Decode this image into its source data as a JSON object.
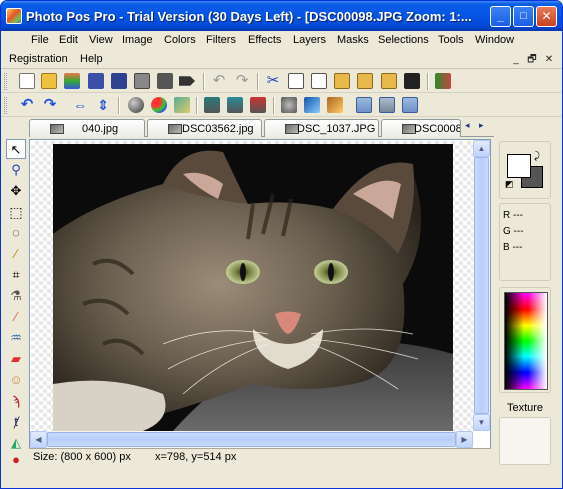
{
  "window": {
    "title": "Photo Pos Pro - Trial Version (30 Days Left) - [DSC00098.JPG  Zoom: 1:...",
    "controls": {
      "minimize": "_",
      "maximize": "□",
      "close": "✕"
    }
  },
  "menubar": {
    "items": [
      "File",
      "Edit",
      "View",
      "Image",
      "Colors",
      "Filters",
      "Effects",
      "Layers",
      "Masks",
      "Selections",
      "Tools",
      "Window"
    ],
    "items_row2": [
      "Registration",
      "Help"
    ],
    "mdi_controls": [
      "_",
      "🗗",
      "✕"
    ]
  },
  "tabs": [
    {
      "label": "040.jpg"
    },
    {
      "label": "DSC03562.jpg"
    },
    {
      "label": "DSC_1037.JPG"
    },
    {
      "label": "DSC0008"
    }
  ],
  "tab_scroll": {
    "left": "◂",
    "right": "▸"
  },
  "statusbar": {
    "size": "Size: (800 x 600) px",
    "coords": "x=798, y=514 px"
  },
  "colorpanel": {
    "r": "R ---",
    "g": "G ---",
    "b": "B ---"
  },
  "texture": {
    "label": "Texture"
  },
  "scroll_glyphs": {
    "up": "▲",
    "down": "▼",
    "left": "◀",
    "right": "▶"
  },
  "icons": {
    "toolbox": [
      "select-arrow-icon",
      "zoom-icon",
      "move-icon",
      "rect-select-icon",
      "lasso-icon",
      "magic-wand-icon",
      "crop-icon",
      "eyedropper-icon",
      "brush-icon",
      "fill-icon",
      "eraser-icon",
      "clone-stamp-icon",
      "smudge-icon",
      "text-icon",
      "shape-icon",
      "red-eye-icon"
    ]
  }
}
